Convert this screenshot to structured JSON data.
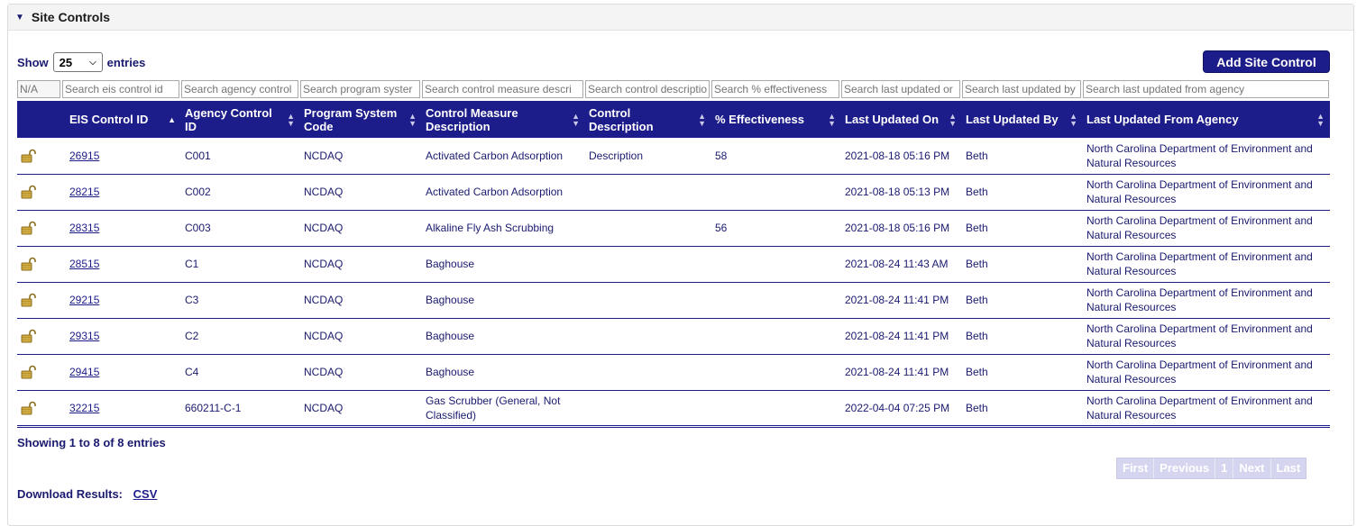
{
  "panel": {
    "title": "Site Controls"
  },
  "length": {
    "show_label": "Show",
    "value": "25",
    "entries_label": "entries"
  },
  "add_button": "Add Site Control",
  "filters": [
    {
      "placeholder": "N/A"
    },
    {
      "placeholder": "Search eis control id"
    },
    {
      "placeholder": "Search agency control"
    },
    {
      "placeholder": "Search program syster"
    },
    {
      "placeholder": "Search control measure descri"
    },
    {
      "placeholder": "Search control descriptio"
    },
    {
      "placeholder": "Search % effectiveness"
    },
    {
      "placeholder": "Search last updated or"
    },
    {
      "placeholder": "Search last updated by"
    },
    {
      "placeholder": "Search last updated from agency"
    }
  ],
  "columns": [
    "",
    "EIS Control ID",
    "Agency Control ID",
    "Program System Code",
    "Control Measure Description",
    "Control Description",
    "% Effectiveness",
    "Last Updated On",
    "Last Updated By",
    "Last Updated From Agency"
  ],
  "rows": [
    {
      "eis_id": "26915",
      "agency_id": "C001",
      "program": "NCDAQ",
      "measure": "Activated Carbon Adsorption",
      "description": "Description",
      "effectiveness": "58",
      "updated_on": "2021-08-18 05:16 PM",
      "updated_by": "Beth",
      "agency": "North Carolina Department of Environment and Natural Resources"
    },
    {
      "eis_id": "28215",
      "agency_id": "C002",
      "program": "NCDAQ",
      "measure": "Activated Carbon Adsorption",
      "description": "",
      "effectiveness": "",
      "updated_on": "2021-08-18 05:13 PM",
      "updated_by": "Beth",
      "agency": "North Carolina Department of Environment and Natural Resources"
    },
    {
      "eis_id": "28315",
      "agency_id": "C003",
      "program": "NCDAQ",
      "measure": "Alkaline Fly Ash Scrubbing",
      "description": "",
      "effectiveness": "56",
      "updated_on": "2021-08-18 05:16 PM",
      "updated_by": "Beth",
      "agency": "North Carolina Department of Environment and Natural Resources"
    },
    {
      "eis_id": "28515",
      "agency_id": "C1",
      "program": "NCDAQ",
      "measure": "Baghouse",
      "description": "",
      "effectiveness": "",
      "updated_on": "2021-08-24 11:43 AM",
      "updated_by": "Beth",
      "agency": "North Carolina Department of Environment and Natural Resources"
    },
    {
      "eis_id": "29215",
      "agency_id": "C3",
      "program": "NCDAQ",
      "measure": "Baghouse",
      "description": "",
      "effectiveness": "",
      "updated_on": "2021-08-24 11:41 PM",
      "updated_by": "Beth",
      "agency": "North Carolina Department of Environment and Natural Resources"
    },
    {
      "eis_id": "29315",
      "agency_id": "C2",
      "program": "NCDAQ",
      "measure": "Baghouse",
      "description": "",
      "effectiveness": "",
      "updated_on": "2021-08-24 11:41 PM",
      "updated_by": "Beth",
      "agency": "North Carolina Department of Environment and Natural Resources"
    },
    {
      "eis_id": "29415",
      "agency_id": "C4",
      "program": "NCDAQ",
      "measure": "Baghouse",
      "description": "",
      "effectiveness": "",
      "updated_on": "2021-08-24 11:41 PM",
      "updated_by": "Beth",
      "agency": "North Carolina Department of Environment and Natural Resources"
    },
    {
      "eis_id": "32215",
      "agency_id": "660211-C-1",
      "program": "NCDAQ",
      "measure": "Gas Scrubber (General, Not Classified)",
      "description": "",
      "effectiveness": "",
      "updated_on": "2022-04-04 07:25 PM",
      "updated_by": "Beth",
      "agency": "North Carolina Department of Environment and Natural Resources"
    }
  ],
  "info": "Showing 1 to 8 of 8 entries",
  "pager": {
    "first": "First",
    "previous": "Previous",
    "page": "1",
    "next": "Next",
    "last": "Last"
  },
  "download": {
    "label": "Download Results:",
    "csv": "CSV"
  },
  "colors": {
    "header_bg": "#1c1c8a",
    "text": "#1a1a70",
    "lock": "#c8a23a"
  },
  "icons": {
    "lock": "unlocked-padlock-icon",
    "caret": "caret-down-icon"
  }
}
